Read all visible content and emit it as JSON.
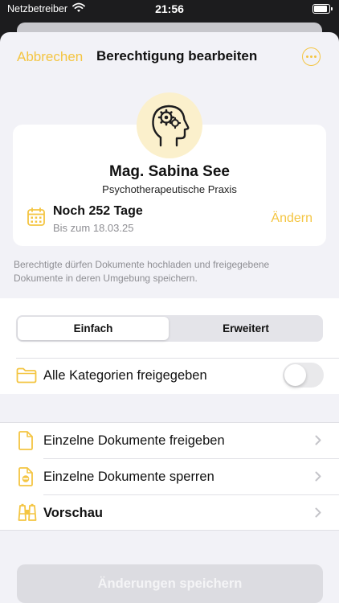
{
  "status_bar": {
    "carrier": "Netzbetreiber",
    "time": "21:56"
  },
  "nav": {
    "cancel_label": "Abbrechen",
    "title": "Berechtigung bearbeiten",
    "more_icon": "ellipsis-circle-icon"
  },
  "profile": {
    "avatar_icon": "head-gears-icon",
    "name": "Mag. Sabina See",
    "organization": "Psychotherapeutische Praxis",
    "remaining": "Noch 252 Tage",
    "until": "Bis zum 18.03.25",
    "change_label": "Ändern"
  },
  "description": "Berechtigte dürfen Dokumente hochladen und freigegebene Dokumente in deren Umgebung speichern.",
  "segment": {
    "options": [
      "Einfach",
      "Erweitert"
    ],
    "selected": "Einfach"
  },
  "categories": {
    "label": "Alle Kategorien freigegeben",
    "enabled": false
  },
  "list": [
    {
      "label": "Einzelne Dokumente freigeben",
      "icon": "document-icon"
    },
    {
      "label": "Einzelne Dokumente sperren",
      "icon": "document-blocked-icon"
    },
    {
      "label": "Vorschau",
      "icon": "binoculars-icon"
    }
  ],
  "save_label": "Änderungen speichern",
  "colors": {
    "accent": "#f4c542",
    "avatar_bg": "#fbf0cc",
    "background": "#f2f2f7",
    "disabled_button": "#dcdce1"
  }
}
